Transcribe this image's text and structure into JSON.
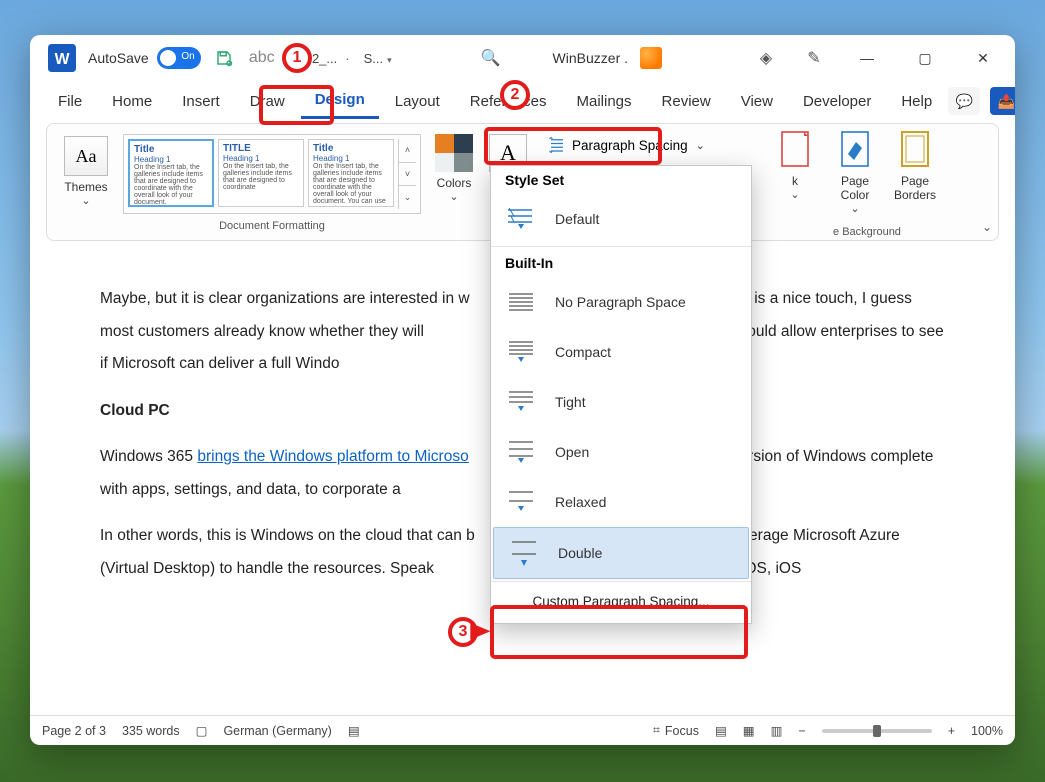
{
  "titlebar": {
    "autosave_label": "AutoSave",
    "autosave_state": "On",
    "doc_name": "02_...",
    "doc_status": "S...",
    "app_title": "WinBuzzer ."
  },
  "tabs": {
    "items": [
      "File",
      "Home",
      "Insert",
      "Draw",
      "Design",
      "Layout",
      "References",
      "Mailings",
      "Review",
      "View",
      "Developer",
      "Help"
    ],
    "active": "Design"
  },
  "ribbon": {
    "themes_label": "Themes",
    "colors_label": "Colors",
    "fonts_label": "Fonts",
    "paragraph_spacing_label": "Paragraph Spacing",
    "watermark_label": "k",
    "page_color_label": "Page Color",
    "page_borders_label": "Page Borders",
    "group_formatting": "Document Formatting",
    "group_background": "e Background",
    "style_cards": [
      {
        "title": "Title",
        "heading": "Heading 1"
      },
      {
        "title": "TITLE",
        "heading": "Heading 1"
      },
      {
        "title": "Title",
        "heading": "Heading 1"
      }
    ]
  },
  "dropdown": {
    "section1": "Style Set",
    "default": "Default",
    "section2": "Built-In",
    "items": [
      "No Paragraph Space",
      "Compact",
      "Tight",
      "Open",
      "Relaxed",
      "Double"
    ],
    "custom": "Custom Paragraph Spacing..."
  },
  "document": {
    "p1": "Maybe, but it is clear organizations are interested in w",
    "p1b": " free trial is a nice touch, I guess most customers already know whether they will",
    "p1c": "having a trail would allow enterprises to see if Microsoft can deliver a full Windo",
    "h1": "Cloud PC",
    "p2a": "Windows 365 ",
    "p2link": "brings the Windows platform to Microso",
    "p2b": "ecure version of Windows complete with apps, settings, and data, to corporate a",
    "p3a": "In other words, this is Windows on the cloud that can b",
    "p3b": "t will leverage Microsoft Azure (Virtual Desktop) to handle the resources. Speak",
    "p3c": "rts Mac, iPadOS, iOS"
  },
  "statusbar": {
    "page": "Page 2 of 3",
    "words": "335 words",
    "lang": "German (Germany)",
    "focus": "Focus",
    "zoom": "100%"
  },
  "annotations": {
    "b1": "1",
    "b2": "2",
    "b3": "3"
  }
}
